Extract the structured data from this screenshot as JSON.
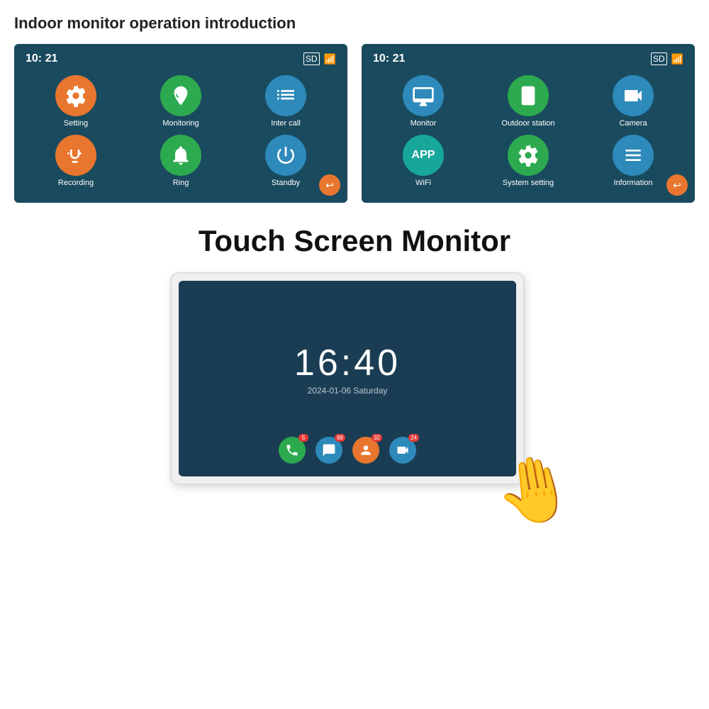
{
  "page": {
    "title": "Indoor monitor operation introduction",
    "touch_title": "Touch Screen Monitor"
  },
  "screen1": {
    "time": "10: 21",
    "apps": [
      {
        "label": "Setting",
        "color": "orange",
        "icon": "gear"
      },
      {
        "label": "Monitoring",
        "color": "green",
        "icon": "camera-circle"
      },
      {
        "label": "Inter call",
        "color": "blue",
        "icon": "sliders"
      },
      {
        "label": "Recording",
        "color": "orange",
        "icon": "people"
      },
      {
        "label": "Ring",
        "color": "green",
        "icon": "bell"
      },
      {
        "label": "Standby",
        "color": "blue",
        "icon": "power"
      }
    ]
  },
  "screen2": {
    "time": "10: 21",
    "apps": [
      {
        "label": "Monitor",
        "color": "blue",
        "icon": "monitor"
      },
      {
        "label": "Outdoor station",
        "color": "green",
        "icon": "outdoor"
      },
      {
        "label": "Camera",
        "color": "blue",
        "icon": "cctv"
      },
      {
        "label": "WiFi",
        "color": "teal",
        "icon": "wifi-app"
      },
      {
        "label": "System setting",
        "color": "green",
        "icon": "gear2"
      },
      {
        "label": "Information",
        "color": "blue",
        "icon": "list"
      }
    ]
  },
  "monitor_screen": {
    "time": "16:40",
    "date": "2024-01-06  Saturday",
    "apps": [
      {
        "icon": "phone",
        "color": "green",
        "badge": "5"
      },
      {
        "icon": "chat",
        "color": "blue",
        "badge": "99"
      },
      {
        "icon": "person",
        "color": "orange",
        "badge": "32"
      },
      {
        "icon": "video",
        "color": "blue",
        "badge": "24"
      }
    ]
  }
}
